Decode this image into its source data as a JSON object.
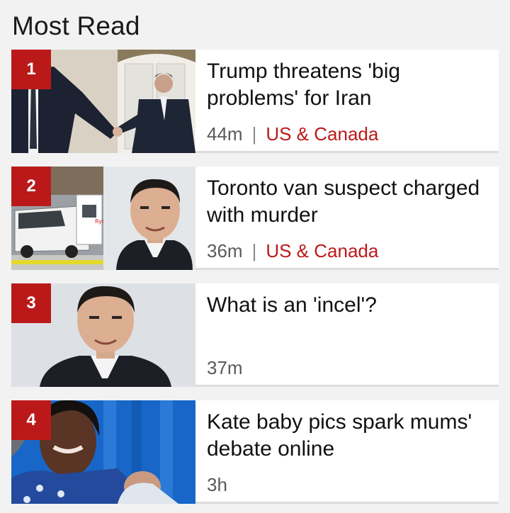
{
  "section": {
    "title": "Most Read"
  },
  "items": [
    {
      "rank": "1",
      "headline": "Trump threatens 'big problems' for Iran",
      "time": "44m",
      "category": "US & Canada",
      "image": "handshake-photo"
    },
    {
      "rank": "2",
      "headline": "Toronto van suspect charged with murder",
      "time": "36m",
      "category": "US & Canada",
      "image": "van-and-portrait-photo"
    },
    {
      "rank": "3",
      "headline": "What is an 'incel'?",
      "time": "37m",
      "category": "",
      "image": "portrait-photo"
    },
    {
      "rank": "4",
      "headline": "Kate baby pics spark mums' debate online",
      "time": "3h",
      "category": "",
      "image": "mother-and-baby-photo"
    }
  ],
  "colors": {
    "accent": "#bb1919",
    "background": "#f2f2f2",
    "card": "#ffffff"
  }
}
